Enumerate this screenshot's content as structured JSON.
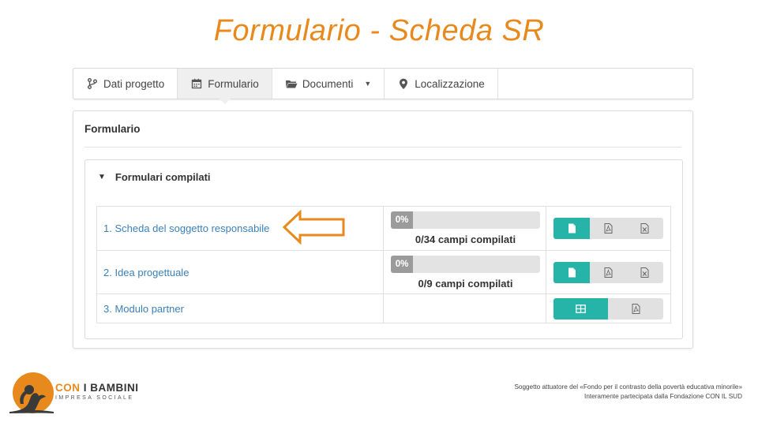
{
  "slide": {
    "title": "Formulario - Scheda SR"
  },
  "tabs": [
    {
      "label": "Dati progetto",
      "icon": "branch-icon"
    },
    {
      "label": "Formulario",
      "icon": "calendar-icon",
      "active": true
    },
    {
      "label": "Documenti",
      "icon": "folder-icon",
      "dropdown": true
    },
    {
      "label": "Localizzazione",
      "icon": "map-pin-icon"
    }
  ],
  "panel": {
    "title": "Formulario",
    "section_title": "Formulari compilati",
    "rows": [
      {
        "name": "1. Scheda del soggetto responsabile",
        "progress": 0,
        "progress_label": "0%",
        "fields": "0/34 campi compilati"
      },
      {
        "name": "2. Idea progettuale",
        "progress": 0,
        "progress_label": "0%",
        "fields": "0/9 campi compilati"
      },
      {
        "name": "3. Modulo partner"
      }
    ]
  },
  "colors": {
    "accent": "#e8891e",
    "primary_button": "#26b3a8",
    "link": "#3b80b9"
  },
  "logo": {
    "line1_a": "CON",
    "line1_b": "I",
    "line1_c": "BAMBINI",
    "line2": "IMPRESA SOCIALE"
  },
  "footer": {
    "line1": "Soggetto attuatore del «Fondo per il contrasto della povertà educativa minorile»",
    "line2": "Interamente partecipata dalla Fondazione CON IL SUD"
  }
}
